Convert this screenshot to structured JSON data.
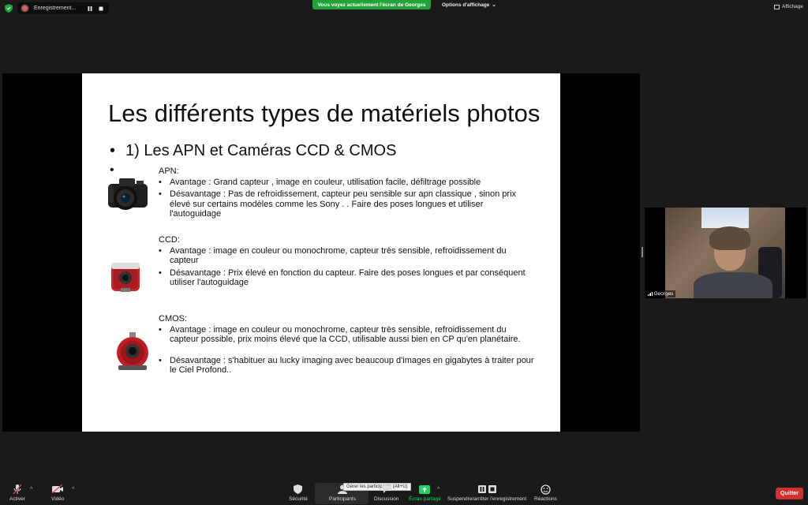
{
  "top": {
    "recording_label": "Enregistrement...",
    "viewing_banner": "Vous voyez actuellement l'écran de Georges",
    "view_options": "Options d'affichage",
    "view_options_caret": "⌄",
    "layout_button": "Affichage"
  },
  "slide": {
    "title": "Les différents types de matériels photos",
    "subtitle": "1) Les APN et Caméras CCD & CMOS",
    "sections": [
      {
        "header": "APN:",
        "camera_icon": "dslr-camera",
        "items": [
          "Avantage : Grand capteur , image en couleur, utilisation facile, défiltrage possible",
          "Désavantage : Pas de refroidissement, capteur peu sensible sur apn classique , sinon prix élevé sur certains modèles comme les Sony . . Faire des poses longues et utiliser l'autoguidage"
        ]
      },
      {
        "header": "CCD:",
        "camera_icon": "ccd-camera",
        "items": [
          "Avantage : image en couleur ou monochrome, capteur très sensible, refroidissement du capteur",
          "Désavantage : Prix élevé en fonction du capteur. Faire des poses longues et par conséquent utiliser l'autoguidage"
        ]
      },
      {
        "header": "CMOS:",
        "camera_icon": "cmos-camera",
        "items": [
          "Avantage : image en couleur ou monochrome, capteur très sensible, refroidissement du capteur possible, prix moins élevé que la CCD, utilisable aussi bien en CP qu'en planétaire.",
          "Désavantage : s'habituer au lucky imaging avec beaucoup d'images en gigabytes à traiter pour le Ciel Profond.."
        ]
      }
    ]
  },
  "participant": {
    "name": "Georges"
  },
  "toolbar": {
    "audio": "Activer",
    "video": "Vidéo",
    "security": "Sécurité",
    "participants": "Participants",
    "participants_tooltip": "Gérer les participants (Alt+U)",
    "chat": "Discussion",
    "share": "Écran partagé",
    "record": "Suspendre/arrêter l'enregistrement",
    "reactions": "Réactions",
    "quit": "Quitter"
  },
  "colors": {
    "banner_green": "#23a337",
    "quit_red": "#d22f2f",
    "share_green": "#23d160",
    "recording_red": "#e8585a"
  }
}
